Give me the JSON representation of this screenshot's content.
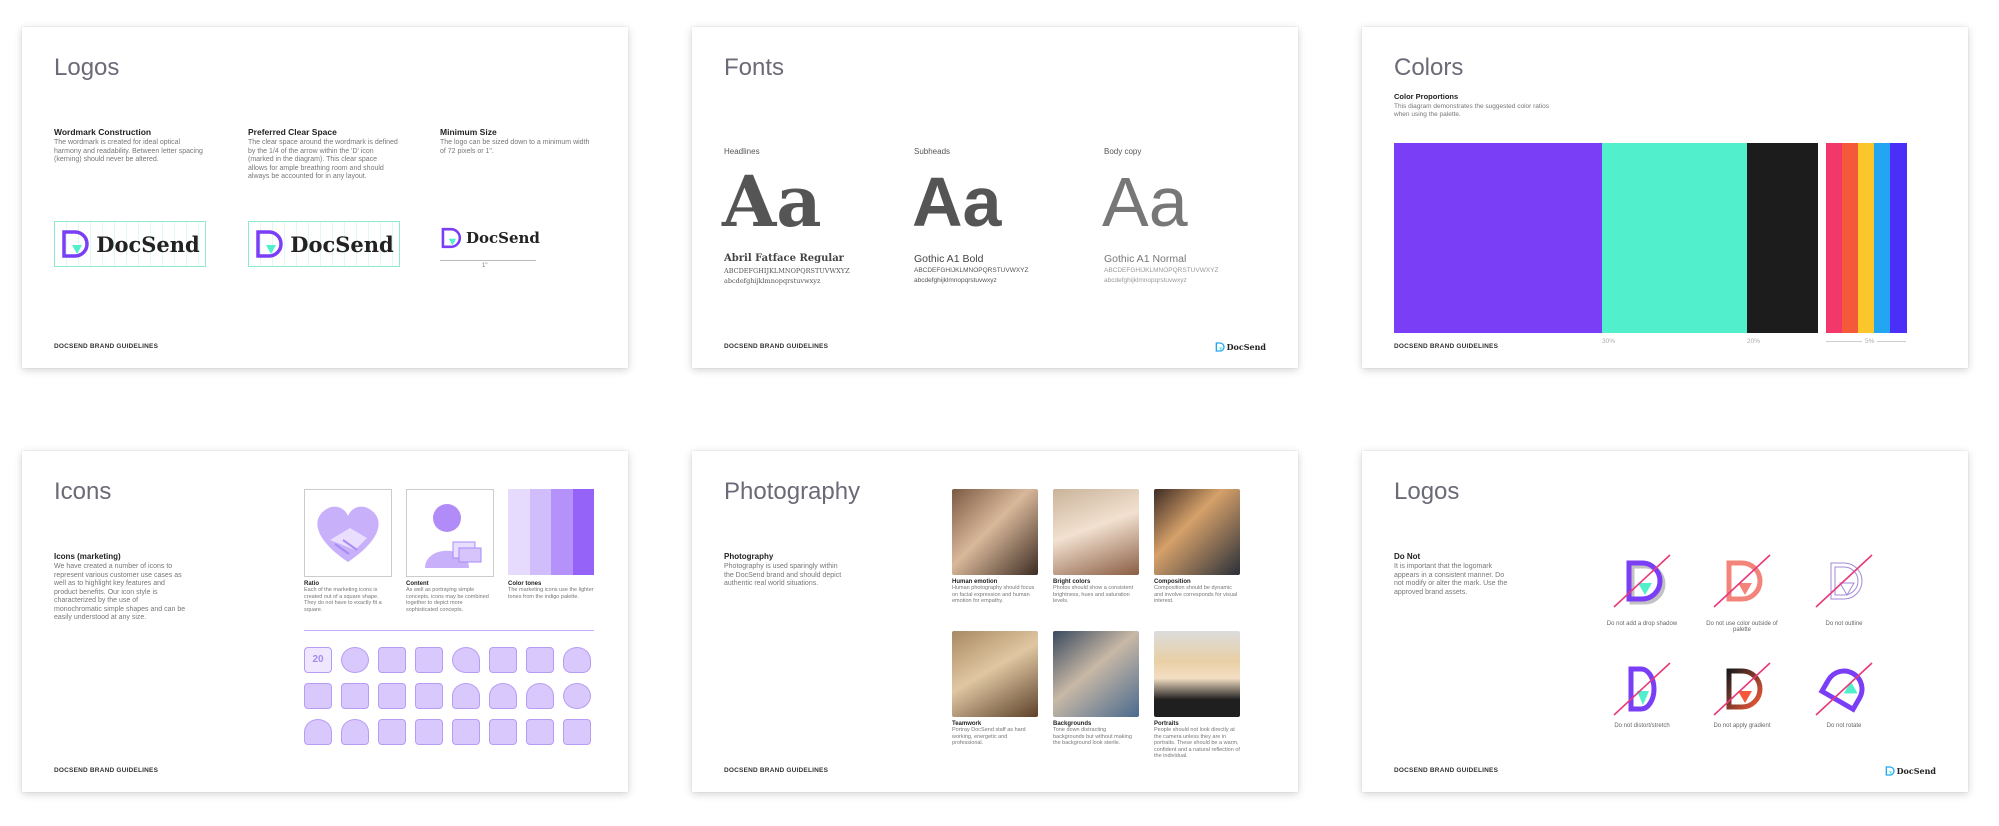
{
  "footer": "DOCSEND BRAND GUIDELINES",
  "brand": "DocSend",
  "colors": {
    "purple": "#7a3ef6",
    "teal": "#52efcd",
    "black": "#1c1c1c",
    "pink": "#f2386b",
    "red": "#f45a3a",
    "orange": "#fb8b24",
    "yellow": "#fbc62a",
    "blue": "#22a6f2",
    "violet": "#4b2ff7"
  },
  "logos": {
    "title": "Logos",
    "sections": [
      {
        "heading": "Wordmark Construction",
        "text": "The wordmark is created for ideal optical harmony and readability. Between letter spacing (kerning) should never be altered."
      },
      {
        "heading": "Preferred Clear Space",
        "text": "The clear space around the wordmark is defined by the 1/4 of the arrow within the 'D' icon (marked in the diagram). This clear space allows for ample breathing room and should always be accounted for in any layout."
      },
      {
        "heading": "Minimum Size",
        "text": "The logo can be sized down to a minimum width of 72 pixels or 1\"."
      }
    ],
    "min_size_label": "1\""
  },
  "fonts": {
    "title": "Fonts",
    "columns": [
      {
        "label": "Headlines",
        "sample": "Aa",
        "name": "Abril Fatface Regular",
        "upper": "ABCDEFGHIJKLMNOPQRSTUVWXYZ",
        "lower": "abcdefghijklmnopqrstuvwxyz"
      },
      {
        "label": "Subheads",
        "sample": "Aa",
        "name": "Gothic A1 Bold",
        "upper": "ABCDEFGHIJKLMNOPQRSTUVWXYZ",
        "lower": "abcdefghijklmnopqrstuvwxyz"
      },
      {
        "label": "Body copy",
        "sample": "Aa",
        "name": "Gothic A1 Normal",
        "upper": "ABCDEFGHIJKLMNOPQRSTUVWXYZ",
        "lower": "abcdefghijklmnopqrstuvwxyz"
      }
    ]
  },
  "colors_card": {
    "title": "Colors",
    "heading": "Color Proportions",
    "text": "This diagram demonstrates the suggested color ratios when using the palette.",
    "pct_1": "30%",
    "pct_2": "20%",
    "pct_3": "5%"
  },
  "icons": {
    "title": "Icons",
    "heading": "Icons (marketing)",
    "text": "We have created a number of icons to represent various customer use cases as well as to highlight key features and product benefits. Our icon style is characterized by the use of monochromatic simple shapes and can be easily understood at any size.",
    "panels": [
      {
        "heading": "Ratio",
        "text": "Each of the marketing icons is created out of a square shape. They do not have to exactly fit a square."
      },
      {
        "heading": "Content",
        "text": "As well as portraying simple concepts, icons may be combined together to depict more sophisticated concepts."
      },
      {
        "heading": "Color tones",
        "text": "The marketing icons use the lighter tones from the indigo palette."
      }
    ],
    "calendar_label": "20"
  },
  "photography": {
    "title": "Photography",
    "heading": "Photography",
    "text": "Photography is used sparingly within the DocSend brand and should depict authentic real world situations.",
    "photos": [
      {
        "heading": "Human emotion",
        "text": "Human photography should focus on facial expression and human emotion for empathy."
      },
      {
        "heading": "Bright colors",
        "text": "Photos should show a consistent brightness, hues and saturation levels."
      },
      {
        "heading": "Composition",
        "text": "Composition should be dynamic and involve corresponds for visual interest."
      },
      {
        "heading": "Teamwork",
        "text": "Portray DocSend staff as hard working, energetic and professional."
      },
      {
        "heading": "Backgrounds",
        "text": "Tone down distracting backgrounds but without making the background look sterile."
      },
      {
        "heading": "Portraits",
        "text": "People should not look directly at the camera unless they are in portraits. These should be a warm, confident and a natural reflection of the individual."
      }
    ]
  },
  "logos_donot": {
    "title": "Logos",
    "heading": "Do Not",
    "text": "It is important that the logomark appears in a consistent manner. Do not modify or alter the mark. Use the approved brand assets.",
    "items": [
      "Do not add a drop shadow",
      "Do not use color outside of palette",
      "Do not outline",
      "Do not distort/stretch",
      "Do not apply gradient",
      "Do not rotate"
    ]
  }
}
